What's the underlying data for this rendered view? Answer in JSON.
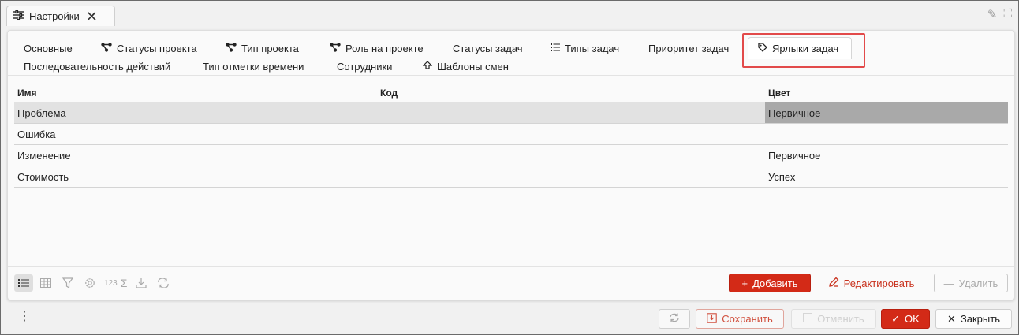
{
  "window": {
    "tab_title": "Настройки"
  },
  "tabs": [
    {
      "label": "Основные",
      "icon": ""
    },
    {
      "label": "Статусы проекта",
      "icon": "network-icon"
    },
    {
      "label": "Тип проекта",
      "icon": "network-icon"
    },
    {
      "label": "Роль на проекте",
      "icon": "network-icon"
    },
    {
      "label": "Статусы задач",
      "icon": ""
    },
    {
      "label": "Типы задач",
      "icon": "list-icon"
    },
    {
      "label": "Приоритет задач",
      "icon": ""
    },
    {
      "label": "Ярлыки задач",
      "icon": "tag-icon",
      "active": true
    },
    {
      "label": "Последовательность действий",
      "icon": ""
    },
    {
      "label": "Тип отметки времени",
      "icon": ""
    },
    {
      "label": "Сотрудники",
      "icon": ""
    },
    {
      "label": "Шаблоны смен",
      "icon": "diamond-icon"
    }
  ],
  "table": {
    "columns": [
      "Имя",
      "Код",
      "Цвет"
    ],
    "rows": [
      {
        "name": "Проблема",
        "code": "",
        "color": "Первичное",
        "selected": true
      },
      {
        "name": "Ошибка",
        "code": "",
        "color": ""
      },
      {
        "name": "Изменение",
        "code": "",
        "color": "Первичное"
      },
      {
        "name": "Стоимость",
        "code": "",
        "color": "Успех"
      }
    ]
  },
  "toolbar": {
    "sum_label": "123",
    "add_label": "Добавить",
    "edit_label": "Редактировать",
    "delete_label": "Удалить"
  },
  "footer": {
    "save_label": "Сохранить",
    "cancel_label": "Отменить",
    "ok_label": "OK",
    "close_label": "Закрыть"
  },
  "colors": {
    "accent": "#d32a17",
    "highlight_border": "#e24a4a",
    "selected_row": "#e2e2e2",
    "selected_cell": "#a9a9a9"
  }
}
